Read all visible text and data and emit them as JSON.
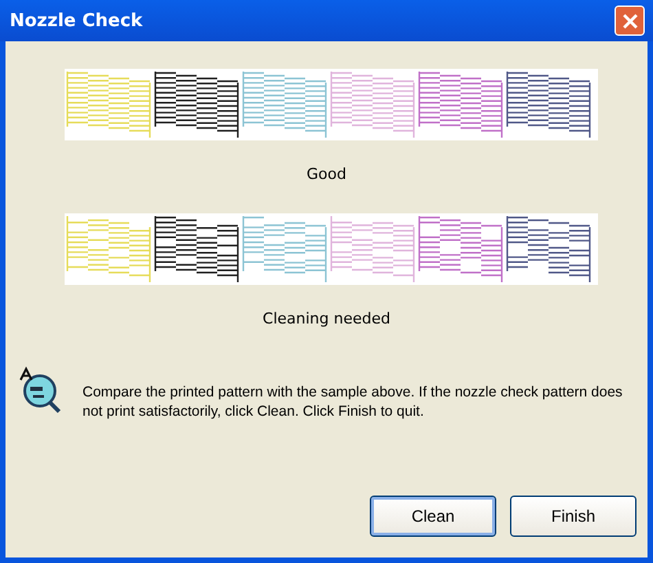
{
  "window": {
    "title": "Nozzle Check"
  },
  "samples": [
    {
      "kind": "good",
      "label": "Good",
      "blocks": [
        {
          "color": "#e6dc5a"
        },
        {
          "color": "#202020"
        },
        {
          "color": "#8cc4d4"
        },
        {
          "color": "#e0b4dc"
        },
        {
          "color": "#c070c8"
        },
        {
          "color": "#505888"
        }
      ]
    },
    {
      "kind": "cleaning",
      "label": "Cleaning needed",
      "blocks": [
        {
          "color": "#e6dc5a"
        },
        {
          "color": "#202020"
        },
        {
          "color": "#8cc4d4"
        },
        {
          "color": "#e0b4dc"
        },
        {
          "color": "#c070c8"
        },
        {
          "color": "#505888"
        }
      ]
    }
  ],
  "message": "Compare the printed pattern with the sample above. If the nozzle check pattern does not print satisfactorily, click Clean. Click Finish to quit.",
  "buttons": [
    {
      "label": "Clean",
      "selected": true
    },
    {
      "label": "Finish",
      "selected": false
    }
  ]
}
